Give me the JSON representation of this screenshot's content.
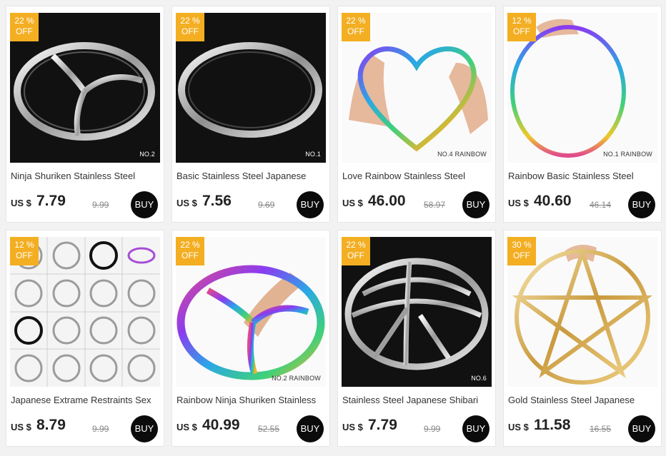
{
  "colors": {
    "badge": "#f3ae22",
    "buy_button": "#0b0b0b",
    "page_background": "#f2f2f2"
  },
  "buy_label": "BUY",
  "products": [
    {
      "discount": "22 %",
      "discount_sub": "OFF",
      "tag": "NO.2",
      "title": "Ninja Shuriken Stainless Steel",
      "currency": "US $",
      "price": "7.79",
      "old_price": "9.99",
      "image": "silver-shuriken-ring-black-bg"
    },
    {
      "discount": "22 %",
      "discount_sub": "OFF",
      "tag": "NO.1",
      "title": "Basic Stainless Steel Japanese",
      "currency": "US $",
      "price": "7.56",
      "old_price": "9.69",
      "image": "silver-plain-ring-black-bg"
    },
    {
      "discount": "22 %",
      "discount_sub": "OFF",
      "tag": "NO.4 RAINBOW",
      "title": "Love Rainbow Stainless Steel",
      "currency": "US $",
      "price": "46.00",
      "old_price": "58.97",
      "image": "rainbow-heart-ring-in-hands"
    },
    {
      "discount": "12 %",
      "discount_sub": "OFF",
      "tag": "NO.1 RAINBOW",
      "title": "Rainbow Basic Stainless Steel",
      "currency": "US $",
      "price": "40.60",
      "old_price": "46.14",
      "image": "rainbow-plain-ring-in-hand"
    },
    {
      "discount": "12 %",
      "discount_sub": "OFF",
      "tag": "",
      "title": "Japanese Extrame Restraints Sex",
      "currency": "US $",
      "price": "8.79",
      "old_price": "9.99",
      "image": "ring-styles-grid"
    },
    {
      "discount": "22 %",
      "discount_sub": "OFF",
      "tag": "NO.2 RAINBOW",
      "title": "Rainbow Ninja Shuriken Stainless",
      "currency": "US $",
      "price": "40.99",
      "old_price": "52.55",
      "image": "rainbow-shuriken-ring-with-arm"
    },
    {
      "discount": "22 %",
      "discount_sub": "OFF",
      "tag": "NO.6",
      "title": "Stainless Steel Japanese Shibari",
      "currency": "US $",
      "price": "7.79",
      "old_price": "9.99",
      "image": "silver-peace-ring-black-bg"
    },
    {
      "discount": "30 %",
      "discount_sub": "OFF",
      "tag": "",
      "title": "Gold Stainless Steel Japanese",
      "currency": "US $",
      "price": "11.58",
      "old_price": "16.55",
      "image": "gold-pentagram-ring"
    }
  ]
}
